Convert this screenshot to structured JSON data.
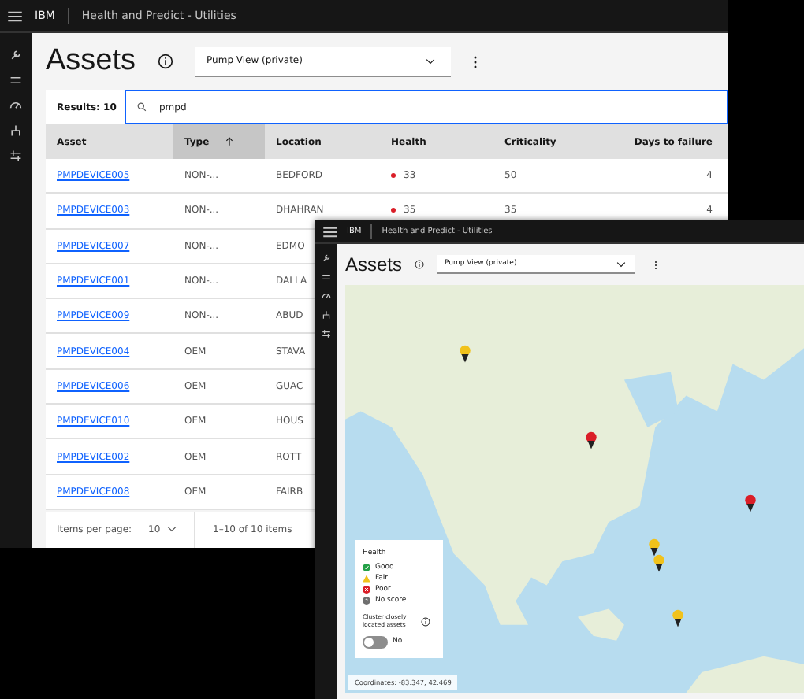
{
  "back_window": {
    "header": {
      "brand": "IBM",
      "app_name": "Health and Predict - Utilities"
    },
    "page_title": "Assets",
    "view_dropdown": {
      "value": "Pump View (private)"
    },
    "results": "Results: 10",
    "search": {
      "value": "pmpd"
    },
    "table": {
      "columns": [
        {
          "label": "Asset",
          "sorted": false
        },
        {
          "label": "Type",
          "sorted": true
        },
        {
          "label": "Location",
          "sorted": false
        },
        {
          "label": "Health",
          "sorted": false
        },
        {
          "label": "Criticality",
          "sorted": false
        },
        {
          "label": "Days to failure",
          "sorted": false
        }
      ],
      "rows": [
        {
          "asset": "PMPDEVICE005",
          "type": "NON-...",
          "location": "BEDFORD",
          "health": "33",
          "criticality": "50",
          "days": "4"
        },
        {
          "asset": "PMPDEVICE003",
          "type": "NON-...",
          "location": "DHAHRAN",
          "health": "35",
          "criticality": "35",
          "days": "4"
        },
        {
          "asset": "PMPDEVICE007",
          "type": "NON-...",
          "location": "EDMO"
        },
        {
          "asset": "PMPDEVICE001",
          "type": "NON-...",
          "location": "DALLA"
        },
        {
          "asset": "PMPDEVICE009",
          "type": "NON-...",
          "location": "ABUD"
        },
        {
          "asset": "PMPDEVICE004",
          "type": "OEM",
          "location": "STAVA"
        },
        {
          "asset": "PMPDEVICE006",
          "type": "OEM",
          "location": "GUAC"
        },
        {
          "asset": "PMPDEVICE010",
          "type": "OEM",
          "location": "HOUS"
        },
        {
          "asset": "PMPDEVICE002",
          "type": "OEM",
          "location": "ROTT"
        },
        {
          "asset": "PMPDEVICE008",
          "type": "OEM",
          "location": "FAIRB"
        }
      ]
    },
    "pagination": {
      "label": "Items per page:",
      "per_page": "10",
      "range": "1–10 of 10 items"
    }
  },
  "front_window": {
    "header": {
      "brand": "IBM",
      "app_name": "Health and Predict - Utilities"
    },
    "page_title": "Assets",
    "view_dropdown": {
      "value": "Pump View (private)"
    },
    "legend": {
      "title": "Health",
      "items": [
        {
          "kind": "good",
          "label": "Good"
        },
        {
          "kind": "fair",
          "label": "Fair"
        },
        {
          "kind": "poor",
          "label": "Poor"
        },
        {
          "kind": "none",
          "label": "No score"
        }
      ],
      "cluster_label": "Cluster closely located assets",
      "cluster_toggle": {
        "on": false,
        "label": "No"
      }
    },
    "coordinates": "Coordinates: -83.347, 42.469"
  }
}
